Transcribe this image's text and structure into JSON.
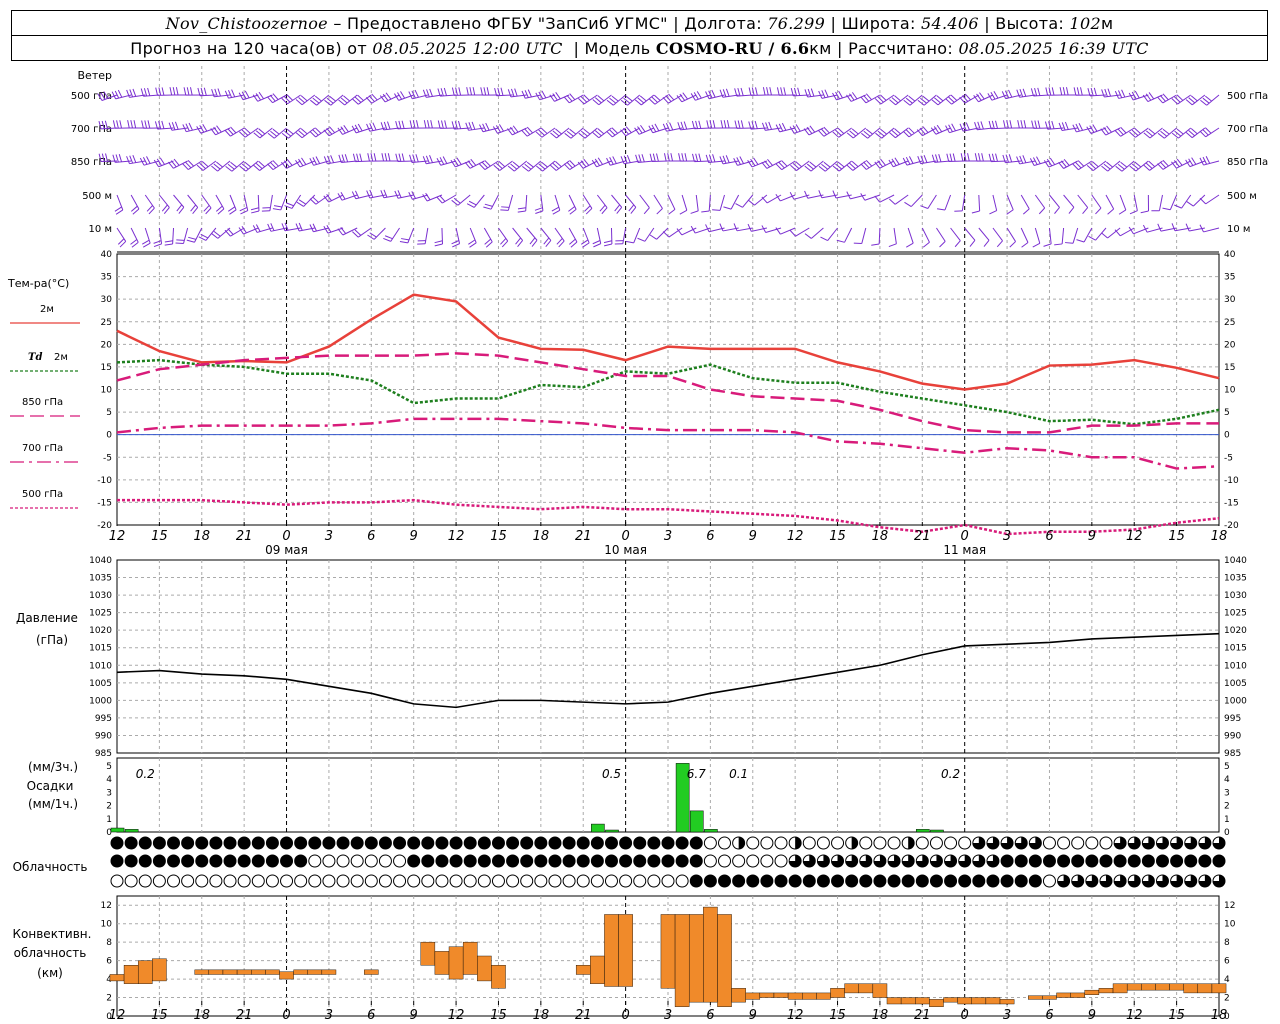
{
  "header": {
    "station": "Nov_Chistoozernoe",
    "provider": " – Предоставлено ФГБУ \"ЗапСиб УГМС\" | Долгота: ",
    "lon": "76.299",
    "lat_label": " | Широта: ",
    "lat": "54.406",
    "alt_label": " | Высота: ",
    "alt": "102",
    "alt_unit": "м",
    "fc_label": "Прогноз на 120 часа(ов) от ",
    "fc_time": "08.05.2025 12:00 UTC",
    "model_label": "  | Модель ",
    "model": "COSMO-RU / 6.6",
    "model_unit": "км",
    "calc_label": " | Рассчитано: ",
    "calc_time": "08.05.2025 16:39 UTC"
  },
  "wind_panel": {
    "title": "Ветер",
    "levels": [
      "500 гПа",
      "700 гПа",
      "850 гПа",
      "500 м",
      "10 м"
    ],
    "barb_color": "#7a2fd0"
  },
  "hour_ticks": [
    "12",
    "15",
    "18",
    "21",
    "0",
    "3",
    "6",
    "9",
    "12",
    "15",
    "18",
    "21",
    "0",
    "3",
    "6",
    "9",
    "12",
    "15",
    "18",
    "21",
    "0",
    "3",
    "6",
    "9",
    "12",
    "15",
    "18"
  ],
  "day_labels": [
    "09 мая",
    "10 мая",
    "11 мая"
  ],
  "chart_data": [
    {
      "type": "line",
      "title": "Тем-ра(°C)",
      "x_hours": [
        0,
        3,
        6,
        9,
        12,
        15,
        18,
        21,
        24,
        27,
        30,
        33,
        36,
        39,
        42,
        45,
        48,
        51,
        54,
        57,
        60,
        63,
        66,
        69,
        72,
        75,
        78
      ],
      "ylim": [
        -20,
        40
      ],
      "series": [
        {
          "name": "2м",
          "color": "#e8413a",
          "style": "solid",
          "values": [
            23,
            18.5,
            16,
            16.3,
            16,
            19.5,
            25.5,
            31,
            29.5,
            21.5,
            19,
            18.8,
            16.5,
            19.5,
            19,
            19,
            19,
            16,
            14,
            11.3,
            10,
            11.3,
            15.3,
            15.5,
            16.5,
            14.8,
            12.5
          ]
        },
        {
          "name": "Td 2м",
          "color": "#1e7f1e",
          "style": "dotted",
          "values": [
            16,
            16.5,
            15.5,
            15,
            13.5,
            13.5,
            12,
            7,
            8,
            8,
            11,
            10.5,
            14,
            13.5,
            15.5,
            12.5,
            11.5,
            11.5,
            9.5,
            8,
            6.5,
            5,
            3,
            3.3,
            2.3,
            3.5,
            5.5
          ]
        },
        {
          "name": "850 гПа",
          "color": "#d81b7a",
          "style": "dash",
          "values": [
            12,
            14.5,
            15.5,
            16.5,
            17,
            17.5,
            17.5,
            17.5,
            18,
            17.5,
            16,
            14.5,
            13,
            13,
            10,
            8.5,
            8,
            7.5,
            5.5,
            3,
            1,
            0.5,
            0.5,
            2,
            2,
            2.5,
            2.5
          ]
        },
        {
          "name": "700 гПа",
          "color": "#d81b7a",
          "style": "dashdot",
          "values": [
            0.5,
            1.5,
            2,
            2,
            2,
            2,
            2.5,
            3.5,
            3.5,
            3.5,
            3,
            2.5,
            1.5,
            1,
            1,
            1,
            0.5,
            -1.5,
            -2,
            -3,
            -4,
            -3,
            -3.5,
            -5,
            -5,
            -7.5,
            -7
          ]
        },
        {
          "name": "500 гПа",
          "color": "#d81b7a",
          "style": "dot",
          "values": [
            -14.5,
            -14.5,
            -14.5,
            -15,
            -15.5,
            -15,
            -15,
            -14.5,
            -15.5,
            -16,
            -16.5,
            -16,
            -16.5,
            -16.5,
            -17,
            -17.5,
            -18,
            -19,
            -20.5,
            -21.5,
            -20,
            -22,
            -21.5,
            -21.5,
            -21,
            -19.5,
            -18.5
          ]
        }
      ]
    },
    {
      "type": "line",
      "title": "Давление",
      "unit": "(гПа)",
      "x_hours": [
        0,
        3,
        6,
        9,
        12,
        15,
        18,
        21,
        24,
        27,
        30,
        33,
        36,
        39,
        42,
        45,
        48,
        51,
        54,
        57,
        60,
        63,
        66,
        69,
        72,
        75,
        78
      ],
      "ylim": [
        985,
        1040
      ],
      "yticks": [
        985,
        990,
        995,
        1000,
        1005,
        1010,
        1015,
        1020,
        1025,
        1030,
        1035,
        1040
      ],
      "series": [
        {
          "name": "pressure",
          "color": "#000000",
          "values": [
            1008,
            1008.5,
            1007.5,
            1007,
            1006,
            1004,
            1002,
            999,
            998,
            1000,
            1000,
            999.5,
            999,
            999.5,
            1002,
            1004,
            1006,
            1008,
            1010,
            1013,
            1015.5,
            1016,
            1016.5,
            1017.5,
            1018,
            1018.5,
            1019
          ]
        }
      ]
    },
    {
      "type": "bar",
      "title": "Осадки",
      "unit_3h": "(мм/3ч.)",
      "unit_1h": "(мм/1ч.)",
      "ylim": [
        0,
        5
      ],
      "yticks": [
        0,
        1,
        2,
        3,
        4,
        5
      ],
      "annotations": [
        {
          "hour": 2,
          "text": "0.2"
        },
        {
          "hour": 35,
          "text": "0.5"
        },
        {
          "hour": 41,
          "text": "6.7"
        },
        {
          "hour": 44,
          "text": "0.1"
        },
        {
          "hour": 59,
          "text": "0.2"
        }
      ],
      "bars_1h": [
        {
          "hour": 0,
          "value": 0.3
        },
        {
          "hour": 1,
          "value": 0.2
        },
        {
          "hour": 34,
          "value": 0.6
        },
        {
          "hour": 35,
          "value": 0.15
        },
        {
          "hour": 40,
          "value": 5.2
        },
        {
          "hour": 41,
          "value": 1.6
        },
        {
          "hour": 42,
          "value": 0.2
        },
        {
          "hour": 57,
          "value": 0.2
        },
        {
          "hour": 58,
          "value": 0.15
        }
      ],
      "color": "#22cc22"
    },
    {
      "type": "bar",
      "title": "Конвективн. облачность",
      "unit": "(км)",
      "ylim": [
        0,
        13
      ],
      "yticks": [
        0,
        2,
        4,
        6,
        8,
        10,
        12
      ],
      "color": "#f08a2a",
      "ranges_km": [
        [
          0,
          3.8,
          4.5
        ],
        [
          1,
          3.5,
          5.5
        ],
        [
          2,
          3.5,
          6
        ],
        [
          3,
          3.8,
          6.2
        ],
        [
          6,
          4.5,
          5
        ],
        [
          7,
          4.5,
          5
        ],
        [
          8,
          4.5,
          5
        ],
        [
          9,
          4.5,
          5
        ],
        [
          10,
          4.5,
          5
        ],
        [
          11,
          4.5,
          5
        ],
        [
          12,
          4,
          4.8
        ],
        [
          13,
          4.5,
          5
        ],
        [
          14,
          4.5,
          5
        ],
        [
          15,
          4.5,
          5
        ],
        [
          18,
          4.5,
          5
        ],
        [
          22,
          5.5,
          8
        ],
        [
          23,
          4.5,
          7
        ],
        [
          24,
          4,
          7.5
        ],
        [
          25,
          4.5,
          8
        ],
        [
          26,
          3.8,
          6.5
        ],
        [
          27,
          3,
          5.5
        ],
        [
          33,
          4.5,
          5.5
        ],
        [
          34,
          3.5,
          6.5
        ],
        [
          35,
          3.2,
          11
        ],
        [
          36,
          3.2,
          11
        ],
        [
          39,
          3,
          11
        ],
        [
          40,
          1,
          11
        ],
        [
          41,
          1.5,
          11
        ],
        [
          42,
          1.5,
          11.8
        ],
        [
          43,
          1,
          11
        ],
        [
          44,
          1.5,
          3
        ],
        [
          45,
          1.8,
          2.5
        ],
        [
          46,
          2,
          2.5
        ],
        [
          47,
          2,
          2.5
        ],
        [
          48,
          1.8,
          2.5
        ],
        [
          49,
          1.8,
          2.5
        ],
        [
          50,
          1.8,
          2.5
        ],
        [
          51,
          2,
          3
        ],
        [
          52,
          2.5,
          3.5
        ],
        [
          53,
          2.5,
          3.5
        ],
        [
          54,
          2,
          3.5
        ],
        [
          55,
          1.3,
          2
        ],
        [
          56,
          1.3,
          2
        ],
        [
          57,
          1.3,
          2
        ],
        [
          58,
          1,
          1.8
        ],
        [
          59,
          1.5,
          2
        ],
        [
          60,
          1.3,
          2
        ],
        [
          61,
          1.3,
          2
        ],
        [
          62,
          1.3,
          2
        ],
        [
          63,
          1.3,
          1.8
        ],
        [
          65,
          1.8,
          2.2
        ],
        [
          66,
          1.8,
          2.2
        ],
        [
          67,
          2,
          2.5
        ],
        [
          68,
          2,
          2.5
        ],
        [
          69,
          2.3,
          2.8
        ],
        [
          70,
          2.5,
          3
        ],
        [
          71,
          2.5,
          3.5
        ],
        [
          72,
          2.8,
          3.5
        ],
        [
          73,
          2.8,
          3.5
        ],
        [
          74,
          2.8,
          3.5
        ],
        [
          75,
          2.8,
          3.5
        ],
        [
          76,
          2.5,
          3.5
        ],
        [
          77,
          2.5,
          3.5
        ],
        [
          78,
          2.5,
          3.5
        ]
      ]
    }
  ],
  "cloud_panel": {
    "title": "Облачность"
  },
  "legend": {
    "td_italic": "Td"
  }
}
